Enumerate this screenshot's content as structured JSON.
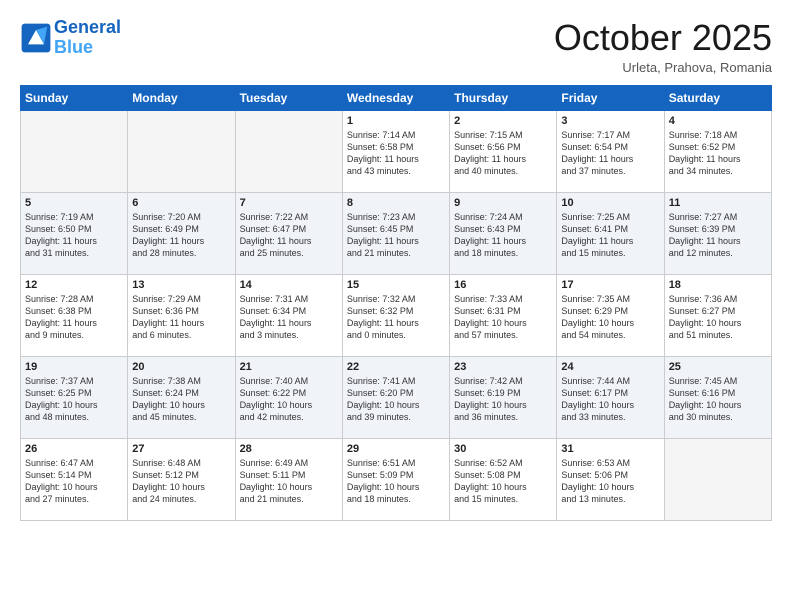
{
  "logo": {
    "line1": "General",
    "line2": "Blue"
  },
  "header": {
    "month": "October 2025",
    "location": "Urleta, Prahova, Romania"
  },
  "weekdays": [
    "Sunday",
    "Monday",
    "Tuesday",
    "Wednesday",
    "Thursday",
    "Friday",
    "Saturday"
  ],
  "weeks": [
    [
      {
        "day": "",
        "info": ""
      },
      {
        "day": "",
        "info": ""
      },
      {
        "day": "",
        "info": ""
      },
      {
        "day": "1",
        "info": "Sunrise: 7:14 AM\nSunset: 6:58 PM\nDaylight: 11 hours\nand 43 minutes."
      },
      {
        "day": "2",
        "info": "Sunrise: 7:15 AM\nSunset: 6:56 PM\nDaylight: 11 hours\nand 40 minutes."
      },
      {
        "day": "3",
        "info": "Sunrise: 7:17 AM\nSunset: 6:54 PM\nDaylight: 11 hours\nand 37 minutes."
      },
      {
        "day": "4",
        "info": "Sunrise: 7:18 AM\nSunset: 6:52 PM\nDaylight: 11 hours\nand 34 minutes."
      }
    ],
    [
      {
        "day": "5",
        "info": "Sunrise: 7:19 AM\nSunset: 6:50 PM\nDaylight: 11 hours\nand 31 minutes."
      },
      {
        "day": "6",
        "info": "Sunrise: 7:20 AM\nSunset: 6:49 PM\nDaylight: 11 hours\nand 28 minutes."
      },
      {
        "day": "7",
        "info": "Sunrise: 7:22 AM\nSunset: 6:47 PM\nDaylight: 11 hours\nand 25 minutes."
      },
      {
        "day": "8",
        "info": "Sunrise: 7:23 AM\nSunset: 6:45 PM\nDaylight: 11 hours\nand 21 minutes."
      },
      {
        "day": "9",
        "info": "Sunrise: 7:24 AM\nSunset: 6:43 PM\nDaylight: 11 hours\nand 18 minutes."
      },
      {
        "day": "10",
        "info": "Sunrise: 7:25 AM\nSunset: 6:41 PM\nDaylight: 11 hours\nand 15 minutes."
      },
      {
        "day": "11",
        "info": "Sunrise: 7:27 AM\nSunset: 6:39 PM\nDaylight: 11 hours\nand 12 minutes."
      }
    ],
    [
      {
        "day": "12",
        "info": "Sunrise: 7:28 AM\nSunset: 6:38 PM\nDaylight: 11 hours\nand 9 minutes."
      },
      {
        "day": "13",
        "info": "Sunrise: 7:29 AM\nSunset: 6:36 PM\nDaylight: 11 hours\nand 6 minutes."
      },
      {
        "day": "14",
        "info": "Sunrise: 7:31 AM\nSunset: 6:34 PM\nDaylight: 11 hours\nand 3 minutes."
      },
      {
        "day": "15",
        "info": "Sunrise: 7:32 AM\nSunset: 6:32 PM\nDaylight: 11 hours\nand 0 minutes."
      },
      {
        "day": "16",
        "info": "Sunrise: 7:33 AM\nSunset: 6:31 PM\nDaylight: 10 hours\nand 57 minutes."
      },
      {
        "day": "17",
        "info": "Sunrise: 7:35 AM\nSunset: 6:29 PM\nDaylight: 10 hours\nand 54 minutes."
      },
      {
        "day": "18",
        "info": "Sunrise: 7:36 AM\nSunset: 6:27 PM\nDaylight: 10 hours\nand 51 minutes."
      }
    ],
    [
      {
        "day": "19",
        "info": "Sunrise: 7:37 AM\nSunset: 6:25 PM\nDaylight: 10 hours\nand 48 minutes."
      },
      {
        "day": "20",
        "info": "Sunrise: 7:38 AM\nSunset: 6:24 PM\nDaylight: 10 hours\nand 45 minutes."
      },
      {
        "day": "21",
        "info": "Sunrise: 7:40 AM\nSunset: 6:22 PM\nDaylight: 10 hours\nand 42 minutes."
      },
      {
        "day": "22",
        "info": "Sunrise: 7:41 AM\nSunset: 6:20 PM\nDaylight: 10 hours\nand 39 minutes."
      },
      {
        "day": "23",
        "info": "Sunrise: 7:42 AM\nSunset: 6:19 PM\nDaylight: 10 hours\nand 36 minutes."
      },
      {
        "day": "24",
        "info": "Sunrise: 7:44 AM\nSunset: 6:17 PM\nDaylight: 10 hours\nand 33 minutes."
      },
      {
        "day": "25",
        "info": "Sunrise: 7:45 AM\nSunset: 6:16 PM\nDaylight: 10 hours\nand 30 minutes."
      }
    ],
    [
      {
        "day": "26",
        "info": "Sunrise: 6:47 AM\nSunset: 5:14 PM\nDaylight: 10 hours\nand 27 minutes."
      },
      {
        "day": "27",
        "info": "Sunrise: 6:48 AM\nSunset: 5:12 PM\nDaylight: 10 hours\nand 24 minutes."
      },
      {
        "day": "28",
        "info": "Sunrise: 6:49 AM\nSunset: 5:11 PM\nDaylight: 10 hours\nand 21 minutes."
      },
      {
        "day": "29",
        "info": "Sunrise: 6:51 AM\nSunset: 5:09 PM\nDaylight: 10 hours\nand 18 minutes."
      },
      {
        "day": "30",
        "info": "Sunrise: 6:52 AM\nSunset: 5:08 PM\nDaylight: 10 hours\nand 15 minutes."
      },
      {
        "day": "31",
        "info": "Sunrise: 6:53 AM\nSunset: 5:06 PM\nDaylight: 10 hours\nand 13 minutes."
      },
      {
        "day": "",
        "info": ""
      }
    ]
  ]
}
